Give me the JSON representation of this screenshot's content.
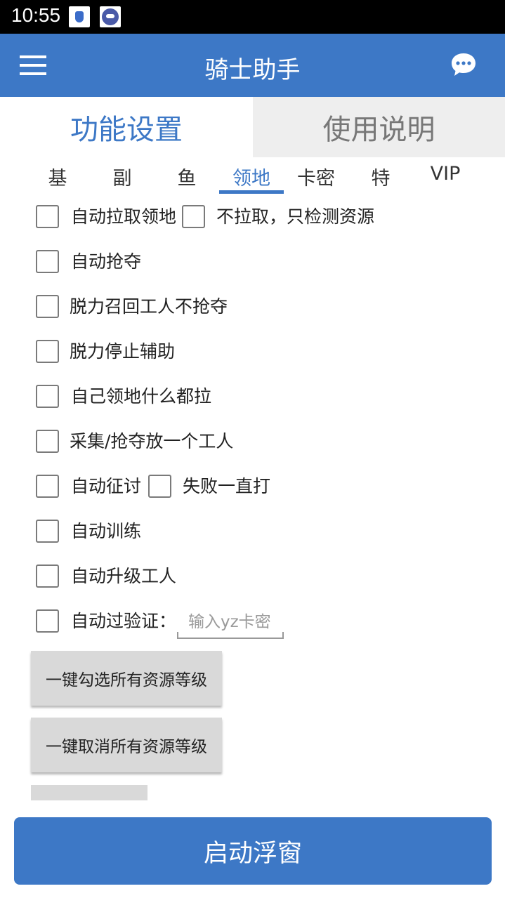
{
  "status_bar": {
    "time": "10:55"
  },
  "app_bar": {
    "title": "骑士助手"
  },
  "main_tabs": [
    {
      "label": "功能设置",
      "active": true
    },
    {
      "label": "使用说明",
      "active": false
    }
  ],
  "sub_tabs": [
    {
      "label": "基"
    },
    {
      "label": "副"
    },
    {
      "label": "鱼"
    },
    {
      "label": "领地",
      "active": true
    },
    {
      "label": "卡密"
    },
    {
      "label": "特"
    },
    {
      "label": "VIP"
    }
  ],
  "options": {
    "auto_pull_territory": {
      "label": "自动拉取领地",
      "checked": false
    },
    "no_pull_only_detect": {
      "label": "不拉取，只检测资源",
      "checked": false
    },
    "auto_plunder": {
      "label": "自动抢夺",
      "checked": false
    },
    "exhausted_recall": {
      "label": "脱力召回工人不抢夺",
      "checked": false
    },
    "exhausted_stop_assist": {
      "label": "脱力停止辅助",
      "checked": false
    },
    "own_territory_pull_all": {
      "label": "自己领地什么都拉",
      "checked": false
    },
    "one_worker": {
      "label": "采集/抢夺放一个工人",
      "checked": false
    },
    "auto_expedition": {
      "label": "自动征讨",
      "checked": false
    },
    "keep_attacking_on_fail": {
      "label": "失败一直打",
      "checked": false
    },
    "auto_train": {
      "label": "自动训练",
      "checked": false
    },
    "auto_upgrade_workers": {
      "label": "自动升级工人",
      "checked": false
    },
    "auto_verify": {
      "label": "自动过验证：",
      "checked": false
    }
  },
  "yz_input": {
    "placeholder": "输入yz卡密",
    "value": ""
  },
  "buttons": {
    "select_all_resource_levels": "一键勾选所有资源等级",
    "cancel_all_resource_levels": "一键取消所有资源等级",
    "start_float": "启动浮窗"
  },
  "colors": {
    "primary": "#3d78c6",
    "status_bar": "#000000",
    "button_gray": "#d9d9d9"
  }
}
